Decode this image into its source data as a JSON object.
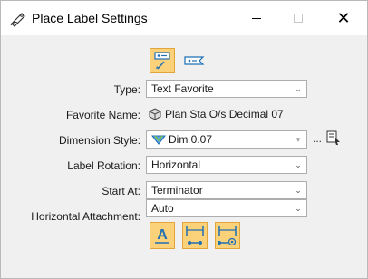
{
  "window": {
    "title": "Place Label Settings",
    "icon": "label-tool-icon",
    "minimize_icon": "minimize-icon",
    "maximize_icon": "maximize-icon",
    "close_glyph": "✕"
  },
  "mode_buttons": [
    {
      "icon": "place-label-leader-icon",
      "active": true
    },
    {
      "icon": "place-label-icon",
      "active": false
    }
  ],
  "fields": {
    "type": {
      "label": "Type:",
      "value": "Text Favorite",
      "kind": "dropdown"
    },
    "favorite_name": {
      "label": "Favorite Name:",
      "value": "Plan Sta O/s Decimal 07",
      "kind": "readonly",
      "icon": "text-favorite-icon"
    },
    "dimension_style": {
      "label": "Dimension Style:",
      "value": "Dim 0.07",
      "kind": "dropdown",
      "icon": "dimension-style-icon",
      "ellipsis": "..."
    },
    "label_rotation": {
      "label": "Label Rotation:",
      "value": "Horizontal",
      "kind": "dropdown"
    },
    "start_at": {
      "label": "Start At:",
      "value": "Terminator",
      "kind": "dropdown"
    },
    "horizontal_attachment": {
      "label": "Horizontal Attachment:",
      "value": "Auto",
      "kind": "dropdown"
    }
  },
  "bottom_buttons": [
    {
      "icon": "text-style-icon",
      "glyph": "A"
    },
    {
      "icon": "dimension-leader-icon"
    },
    {
      "icon": "dimension-leader-at-icon"
    }
  ],
  "colors": {
    "active_bg": "#fbd27a",
    "active_border": "#e2a53a",
    "icon_blue": "#1f6fb5",
    "window_bg": "#f0f0f0"
  }
}
